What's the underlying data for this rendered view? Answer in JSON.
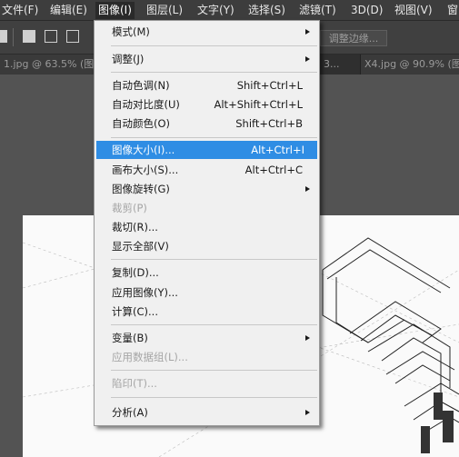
{
  "menubar": {
    "file": "文件(F)",
    "edit": "编辑(E)",
    "image": "图像(I)",
    "layer": "图层(L)",
    "type": "文字(Y)",
    "select": "选择(S)",
    "filter": "滤镜(T)",
    "threed": "3D(D)",
    "view": "视图(V)",
    "window": "窗"
  },
  "options_bar": {
    "refine_edge": "调整边缘..."
  },
  "tabs": {
    "tab1": "1.jpg @ 63.5% (图",
    "tab2": "3...",
    "tab3": "X4.jpg @ 90.9% (图"
  },
  "image_menu": {
    "mode": {
      "label": "模式(M)"
    },
    "adjustments": {
      "label": "调整(J)"
    },
    "auto_tone": {
      "label": "自动色调(N)",
      "shortcut": "Shift+Ctrl+L"
    },
    "auto_contrast": {
      "label": "自动对比度(U)",
      "shortcut": "Alt+Shift+Ctrl+L"
    },
    "auto_color": {
      "label": "自动颜色(O)",
      "shortcut": "Shift+Ctrl+B"
    },
    "image_size": {
      "label": "图像大小(I)...",
      "shortcut": "Alt+Ctrl+I"
    },
    "canvas_size": {
      "label": "画布大小(S)...",
      "shortcut": "Alt+Ctrl+C"
    },
    "image_rotation": {
      "label": "图像旋转(G)"
    },
    "crop": {
      "label": "裁剪(P)"
    },
    "trim": {
      "label": "裁切(R)..."
    },
    "reveal_all": {
      "label": "显示全部(V)"
    },
    "duplicate": {
      "label": "复制(D)..."
    },
    "apply_image": {
      "label": "应用图像(Y)..."
    },
    "calculations": {
      "label": "计算(C)..."
    },
    "variables": {
      "label": "变量(B)"
    },
    "apply_data_set": {
      "label": "应用数据组(L)..."
    },
    "trap": {
      "label": "陷印(T)..."
    },
    "analysis": {
      "label": "分析(A)"
    }
  },
  "colors": {
    "highlight": "#2f8de4",
    "menu_bg": "#f0f0f0",
    "app_bg": "#535353"
  }
}
